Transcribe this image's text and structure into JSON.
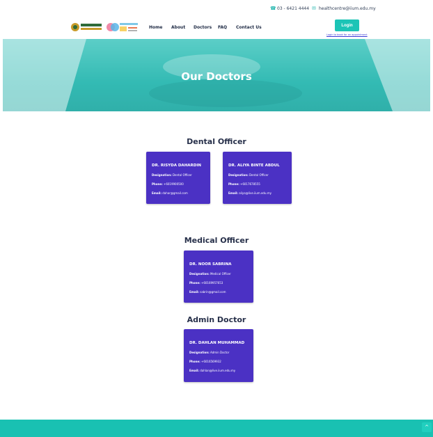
{
  "topbar": {
    "phone": "03 - 6421 4444",
    "email": "healthcentre@iium.edu.my",
    "phone_icon": "phone-icon",
    "email_icon": "email-icon"
  },
  "nav": {
    "items": [
      "Home",
      "About",
      "Doctors",
      "FAQ",
      "Contact Us"
    ],
    "login_label": "Login",
    "login_note": "Login to book for an appointment"
  },
  "hero": {
    "title": "Our Doctors"
  },
  "sections": [
    {
      "title": "Dental Officer",
      "doctors": [
        {
          "name": "DR. RISYDA DAHARDIN",
          "designation": "Dental Officer",
          "phone": "+6019900500",
          "email": "dahar@gmail.com"
        },
        {
          "name": "DR. ALIYA BINTE ABDUL",
          "designation": "Dental Officer",
          "phone": "+6017678555",
          "email": "aliya@live.iium.edu.my"
        }
      ]
    },
    {
      "title": "Medical Officer",
      "doctors": [
        {
          "name": "DR. NOOR SABRINA",
          "designation": "Medical Officer",
          "phone": "+60169957653",
          "email": "sabrin@gmail.com"
        }
      ]
    },
    {
      "title": "Admin Doctor",
      "doctors": [
        {
          "name": "DR. DAHLAN MUHAMMAD",
          "designation": "Admin Doctor",
          "phone": "+6016569932",
          "email": "dahlan@live.iium.edu.my"
        }
      ]
    }
  ],
  "labels": {
    "designation": "Designation:",
    "phone": "Phone:",
    "email": "Email:"
  },
  "colors": {
    "primary": "#1cc4b6",
    "card": "#4b31c4",
    "footer": "#19c1b2"
  }
}
